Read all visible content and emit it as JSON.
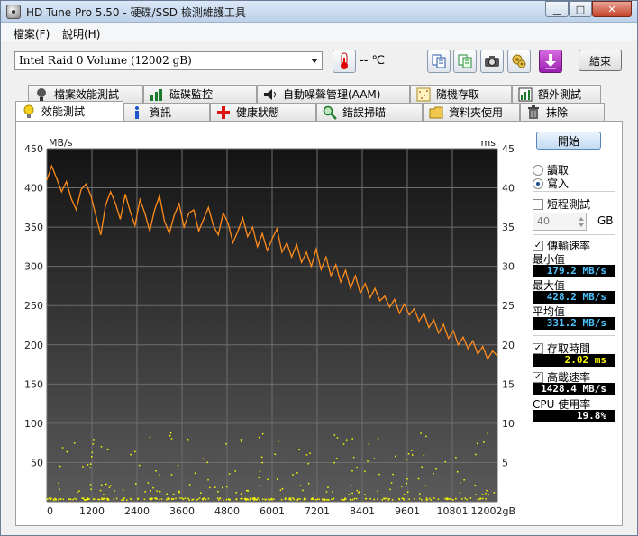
{
  "window": {
    "title": "HD Tune Pro 5.50 - 硬碟/SSD 檢測維護工具",
    "buttons": [
      "minimize",
      "maximize",
      "close"
    ]
  },
  "menu": {
    "file": "檔案(F)",
    "help": "說明(H)"
  },
  "toolbar": {
    "drive": "Intel   Raid 0 Volume (12002 gB)",
    "temperature": "-- ℃",
    "exit_label": "結束",
    "icons": [
      "thermometer-icon",
      "copy-text-icon",
      "copy-info-icon",
      "screenshot-icon",
      "options-icon",
      "save-icon"
    ]
  },
  "tabs": {
    "row1": [
      "檔案效能測試",
      "磁碟監控",
      "自動噪聲管理(AAM)",
      "隨機存取",
      "額外測試"
    ],
    "row2": [
      "效能測試",
      "資訊",
      "健康狀態",
      "錯誤掃瞄",
      "資料夾使用",
      "抹除"
    ],
    "active": "效能測試"
  },
  "side": {
    "start_label": "開始",
    "read_label": "讀取",
    "write_label": "寫入",
    "selected_mode": "write",
    "short_test_label": "短程測試",
    "short_test_checked": false,
    "short_test_size": "40",
    "size_unit": "GB",
    "transfer_rate_label": "傳輸速率",
    "min_label": "最小值",
    "min_value": "179.2 MB/s",
    "max_label": "最大值",
    "max_value": "428.2 MB/s",
    "avg_label": "平均值",
    "avg_value": "331.2 MB/s",
    "access_time_label": "存取時間",
    "access_time_value": "2.02 ms",
    "burst_rate_label": "高載速率",
    "burst_rate_value": "1428.4 MB/s",
    "cpu_label": "CPU 使用率",
    "cpu_value": "19.8%"
  },
  "chart_data": {
    "type": "line",
    "y_left_unit": "MB/s",
    "y_right_unit": "ms",
    "x_ticks": [
      "0",
      "1200",
      "2400",
      "3600",
      "4800",
      "6001",
      "7201",
      "8401",
      "9601",
      "10801",
      "12002gB"
    ],
    "y_left_ticks": [
      450,
      400,
      350,
      300,
      250,
      200,
      150,
      100,
      50
    ],
    "y_right_ticks": [
      45,
      40,
      35,
      30,
      25,
      20,
      15,
      10,
      5
    ],
    "ylim_left": [
      0,
      450
    ],
    "ylim_right": [
      0,
      45
    ],
    "xlim": [
      0,
      12002
    ],
    "grid": true,
    "colors": {
      "transfer": "#ff8c1a",
      "access": "#ffff00",
      "background_top": "#111111",
      "background_bottom": "#5a5a5a"
    },
    "series": [
      {
        "axis": "left",
        "values": [
          410,
          428,
          412,
          395,
          408,
          386,
          372,
          398,
          405,
          390,
          365,
          340,
          378,
          395,
          380,
          360,
          392,
          370,
          352,
          385,
          368,
          345,
          372,
          390,
          358,
          342,
          365,
          380,
          350,
          368,
          372,
          345,
          360,
          375,
          352,
          340,
          368,
          355,
          330,
          345,
          362,
          338,
          350,
          325,
          342,
          320,
          335,
          348,
          318,
          330,
          312,
          328,
          305,
          318,
          300,
          322,
          296,
          312,
          288,
          302,
          280,
          295,
          272,
          288,
          266,
          278,
          260,
          272,
          256,
          262,
          248,
          258,
          240,
          252,
          238,
          246,
          230,
          240,
          222,
          232,
          215,
          226,
          208,
          218,
          200,
          210,
          195,
          205,
          188,
          198,
          182,
          192,
          186
        ]
      },
      {
        "axis": "right",
        "baseline_ms": 0.3,
        "scatter_band_ms": [
          1,
          9
        ]
      }
    ]
  }
}
